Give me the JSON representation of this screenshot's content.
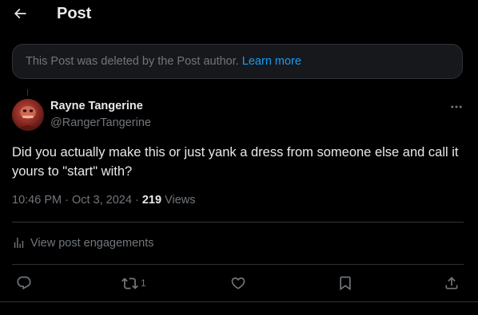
{
  "header": {
    "title": "Post"
  },
  "deleted_notice": {
    "text": "This Post was deleted by the Post author.",
    "link_label": "Learn more"
  },
  "post": {
    "author_name": "Rayne Tangerine",
    "author_handle": "@RangerTangerine",
    "text": "Did you actually make this or just yank a dress from someone else and call it yours to \"start\" with?",
    "time": "10:46 PM",
    "date": "Oct 3, 2024",
    "views_count": "219",
    "views_label": "Views"
  },
  "engagements": {
    "label": "View post engagements"
  },
  "actions": {
    "reply_count": "",
    "repost_count": "1",
    "like_count": "",
    "bookmark_count": ""
  },
  "colors": {
    "background": "#000000",
    "text_primary": "#e7e9ea",
    "text_secondary": "#71767b",
    "link": "#1d9bf0",
    "border": "#2f3336"
  }
}
